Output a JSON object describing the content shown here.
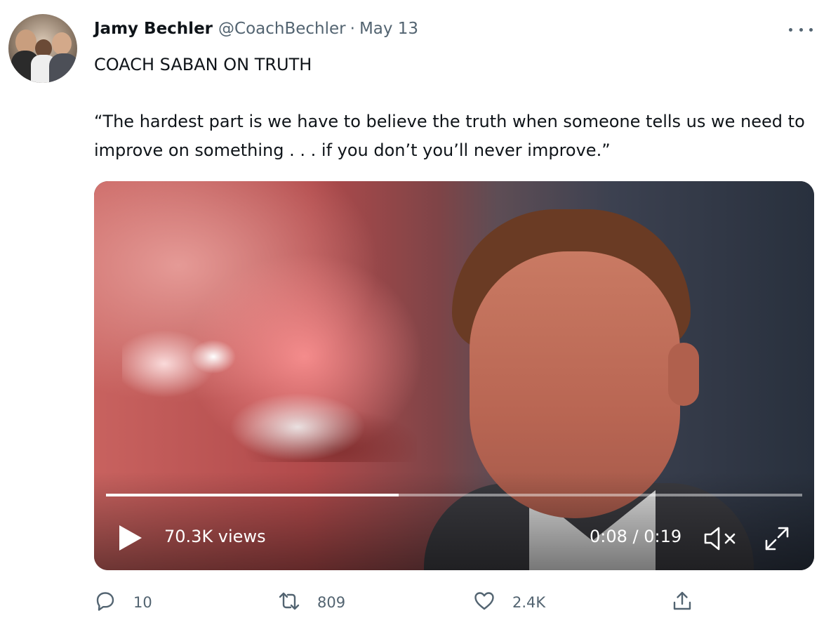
{
  "tweet": {
    "author_name": "Jamy Bechler",
    "handle": "@CoachBechler",
    "separator": "·",
    "date": "May 13",
    "text_line1": "COACH SABAN ON TRUTH",
    "text_quote": "“The hardest part is we have to believe the truth when someone tells us we need to improve on something . . . if you don’t you’ll never improve.”"
  },
  "video": {
    "views": "70.3K views",
    "time": "0:08 / 0:19",
    "progress_fraction": 0.42,
    "muted": true
  },
  "actions": {
    "reply_count": "10",
    "retweet_count": "809",
    "like_count": "2.4K"
  },
  "icons": {
    "more": "more-icon",
    "play": "play-icon",
    "mute": "muted-speaker-icon",
    "fullscreen": "fullscreen-icon",
    "reply": "reply-icon",
    "retweet": "retweet-icon",
    "like": "heart-icon",
    "share": "share-icon"
  },
  "colors": {
    "text": "#0f1419",
    "secondary": "#536471"
  }
}
